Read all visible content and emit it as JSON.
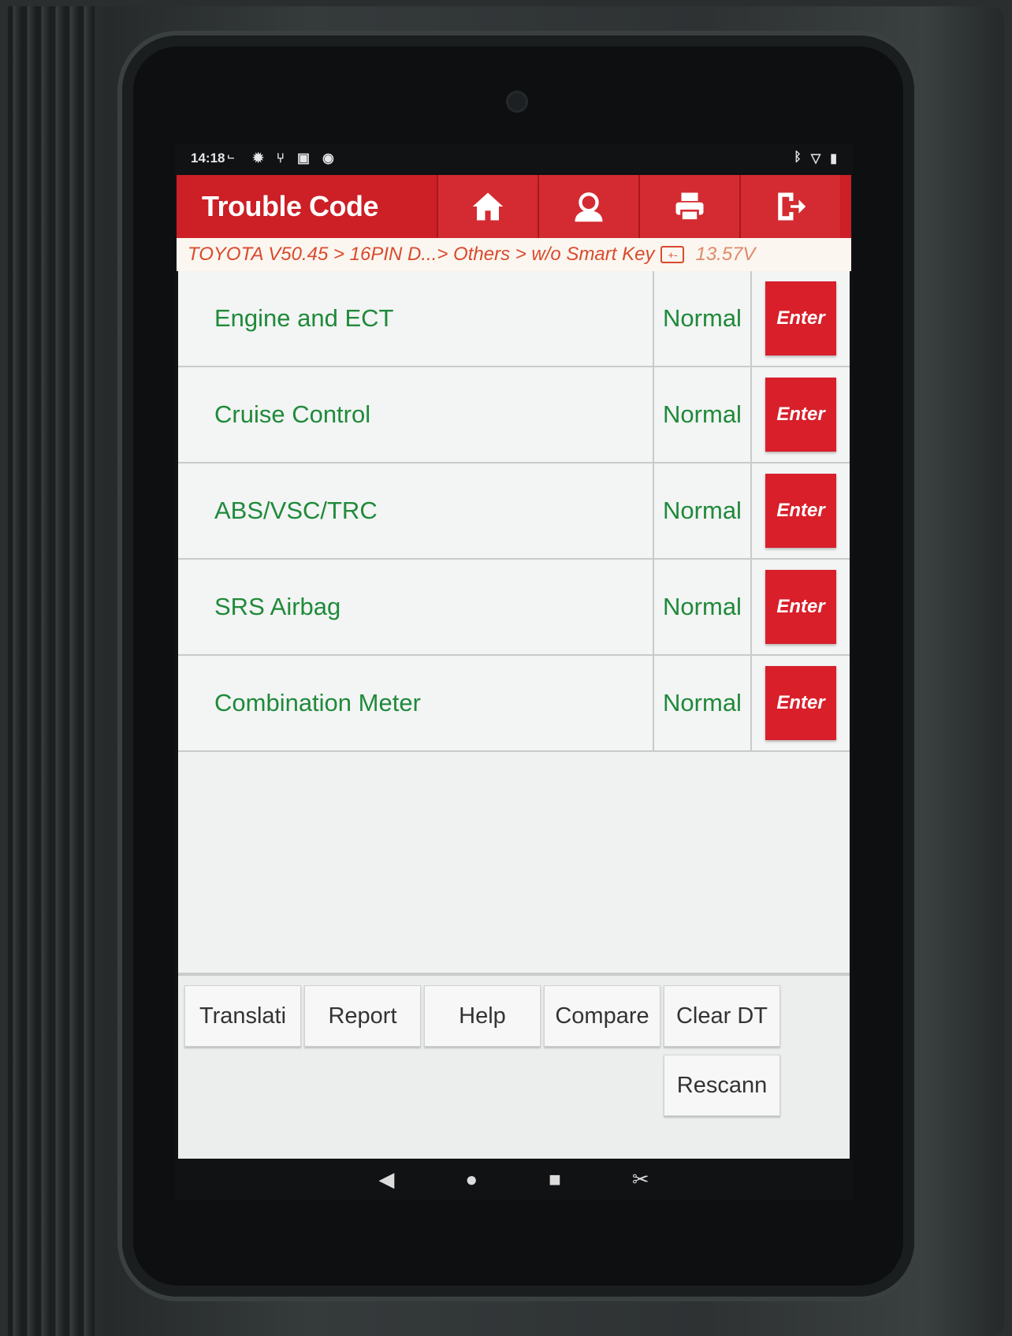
{
  "status_bar": {
    "time": "14:18",
    "indicator": "ᄂ",
    "icons": [
      "gear-icon",
      "usb-icon",
      "image-icon",
      "vpn-icon"
    ],
    "right_icons": [
      "bluetooth-icon",
      "wifi-icon",
      "battery-icon"
    ]
  },
  "header": {
    "title": "Trouble Code",
    "buttons": [
      "home-icon",
      "support-icon",
      "print-icon",
      "exit-icon"
    ]
  },
  "breadcrumb": {
    "path": "TOYOTA V50.45 > 16PIN D...> Others > w/o Smart Key",
    "battery_symbol": "+-",
    "voltage": "13.57V"
  },
  "systems": [
    {
      "name": "Engine and ECT",
      "status": "Normal",
      "action": "Enter"
    },
    {
      "name": "Cruise Control",
      "status": "Normal",
      "action": "Enter"
    },
    {
      "name": "ABS/VSC/TRC",
      "status": "Normal",
      "action": "Enter"
    },
    {
      "name": "SRS Airbag",
      "status": "Normal",
      "action": "Enter"
    },
    {
      "name": "Combination Meter",
      "status": "Normal",
      "action": "Enter"
    }
  ],
  "toolbar": {
    "translation": "Translati",
    "report": "Report",
    "help": "Help",
    "compare": "Compare",
    "clear_dtc": "Clear DT",
    "rescann": "Rescann"
  },
  "nav": {
    "back": "◀",
    "home": "●",
    "recents": "■"
  },
  "colors": {
    "accent": "#cc1f26",
    "status_text": "#1f8a3a",
    "breadcrumb_text": "#d94a2e"
  }
}
